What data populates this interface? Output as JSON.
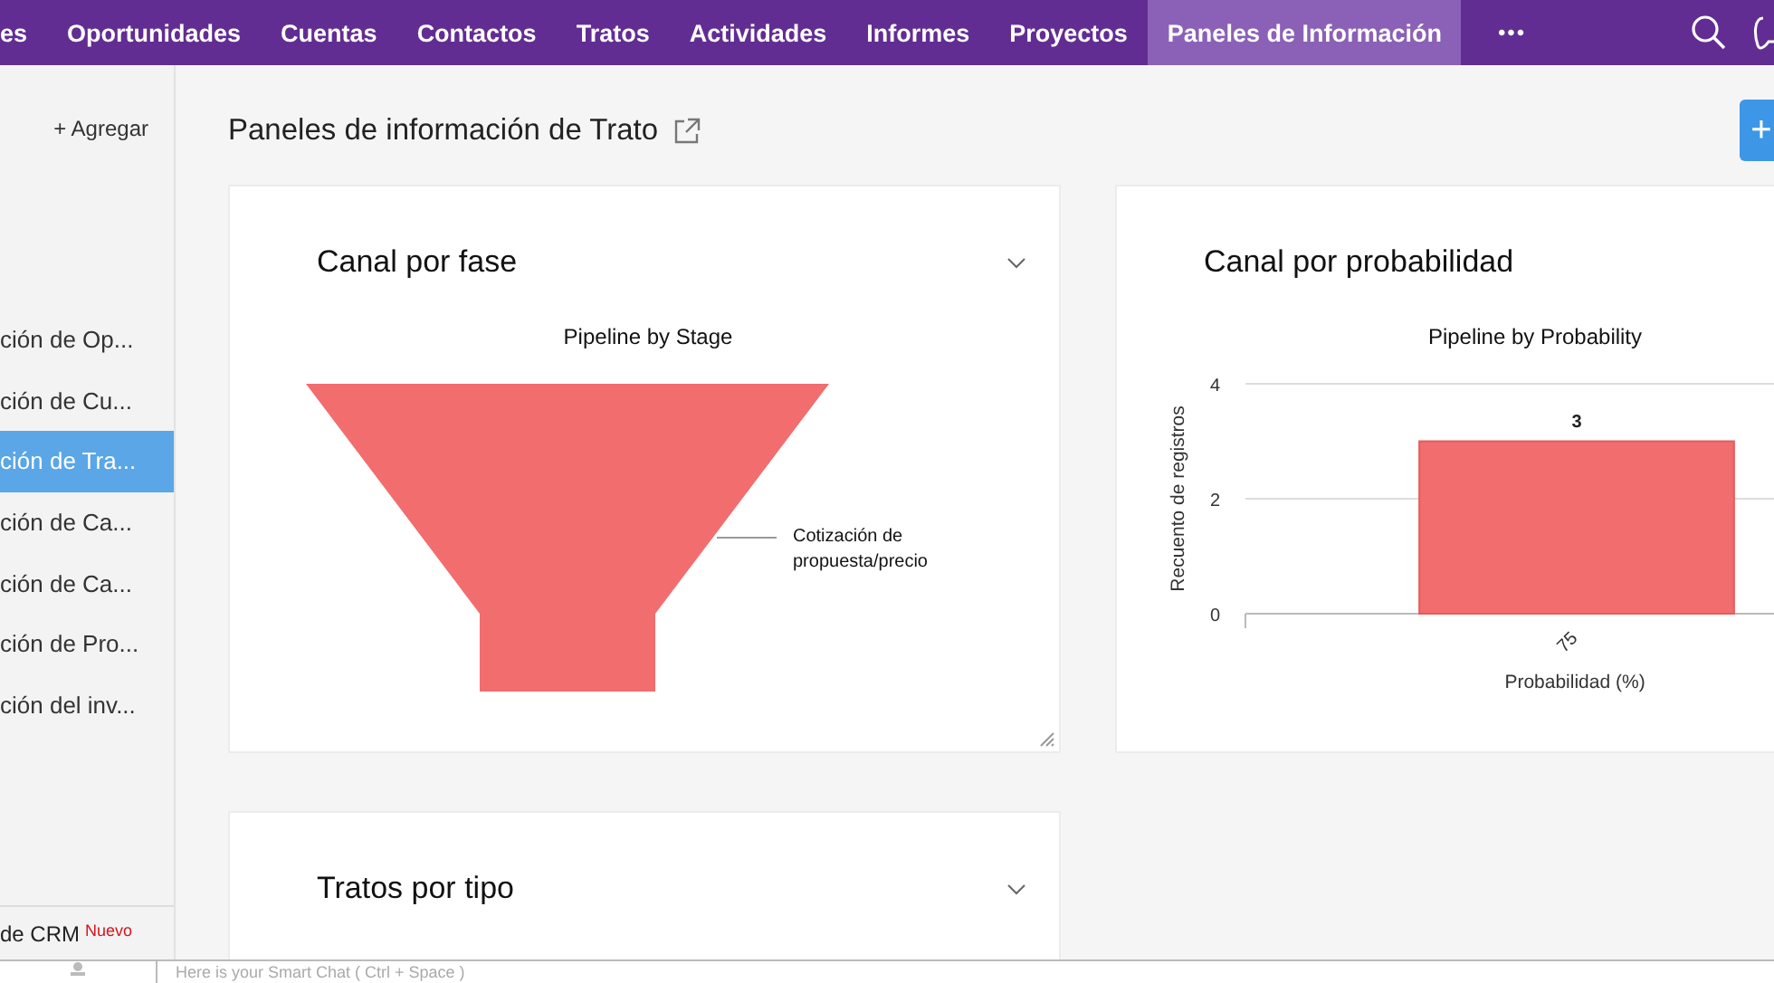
{
  "nav": {
    "items": [
      {
        "label": "es",
        "selected": false
      },
      {
        "label": "Oportunidades",
        "selected": false
      },
      {
        "label": "Cuentas",
        "selected": false
      },
      {
        "label": "Contactos",
        "selected": false
      },
      {
        "label": "Tratos",
        "selected": false
      },
      {
        "label": "Actividades",
        "selected": false
      },
      {
        "label": "Informes",
        "selected": false
      },
      {
        "label": "Proyectos",
        "selected": false
      },
      {
        "label": "Paneles de Información",
        "selected": true
      }
    ],
    "more": "•••"
  },
  "sidebar": {
    "add": "+ Agregar",
    "items": [
      {
        "label": "ción de Op...",
        "selected": false
      },
      {
        "label": "ción de Cu...",
        "selected": false
      },
      {
        "label": "ción de Tra...",
        "selected": true
      },
      {
        "label": "ción de Ca...",
        "selected": false
      },
      {
        "label": "ción de Ca...",
        "selected": false
      },
      {
        "label": "ción de Pro...",
        "selected": false
      },
      {
        "label": "ción del inv...",
        "selected": false
      }
    ],
    "footer": {
      "label": "de CRM",
      "badge": "Nuevo"
    }
  },
  "page": {
    "title": "Paneles de información de Trato",
    "add_button": "+"
  },
  "cards": [
    {
      "title": "Canal por fase",
      "kind": "funnel",
      "funnel": {
        "title": "Pipeline by Stage",
        "stages": [
          {
            "label": "Cotización de propuesta/precio"
          }
        ]
      }
    },
    {
      "title": "Canal por probabilidad",
      "kind": "bar",
      "chart_data": {
        "type": "bar",
        "title": "Pipeline by Probability",
        "xlabel": "Probabilidad (%)",
        "ylabel": "Recuento de registros",
        "categories": [
          "75"
        ],
        "values": [
          3
        ],
        "ylim": [
          0,
          4
        ],
        "yticks": [
          0,
          2,
          4
        ],
        "data_labels": true
      }
    },
    {
      "title": "Tratos por tipo",
      "kind": "empty"
    }
  ],
  "chat": {
    "placeholder": "Here is your Smart Chat ( Ctrl + Space )"
  }
}
